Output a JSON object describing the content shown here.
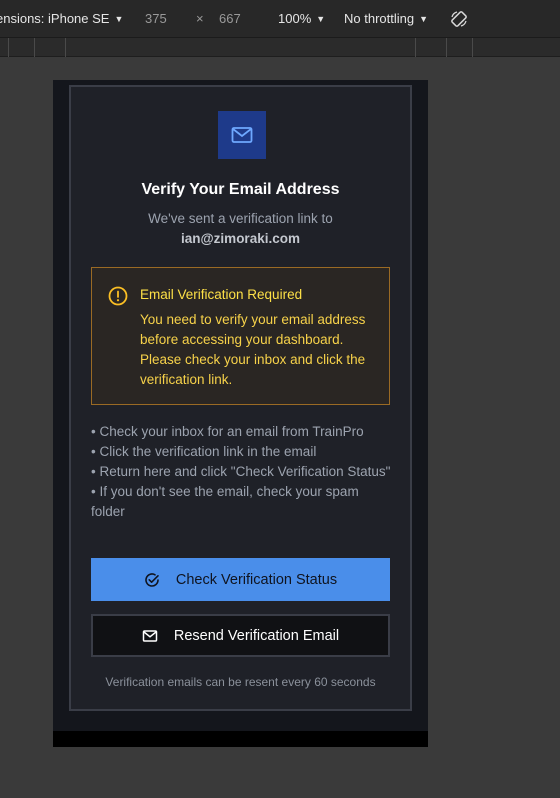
{
  "devtools": {
    "device_label": "ensions: iPhone SE",
    "width": "375",
    "times": "×",
    "height": "667",
    "zoom": "100%",
    "throttling": "No throttling",
    "rotate_icon": "rotate-icon"
  },
  "page": {
    "icon": "mail-icon",
    "title": "Verify Your Email Address",
    "subtitle": "We've sent a verification link to",
    "email": "ian@zimoraki.com",
    "alert": {
      "icon": "warning-icon",
      "title": "Email Verification Required",
      "body": "You need to verify your email address before accessing your dashboard. Please check your inbox and click the verification link."
    },
    "tips": [
      "• Check your inbox for an email from TrainPro",
      "• Click the verification link in the email",
      "• Return here and click \"Check Verification Status\"",
      "• If you don't see the email, check your spam folder"
    ],
    "check_button": {
      "label": "Check Verification Status",
      "icon": "check-circle-icon"
    },
    "resend_button": {
      "label": "Resend Verification Email",
      "icon": "mail-icon"
    },
    "footnote": "Verification emails can be resent every 60 seconds"
  },
  "colors": {
    "primary": "#4a8eea",
    "warning_text": "#fde047",
    "warning_border": "#9a6a24",
    "card_bg": "#1f2128"
  }
}
